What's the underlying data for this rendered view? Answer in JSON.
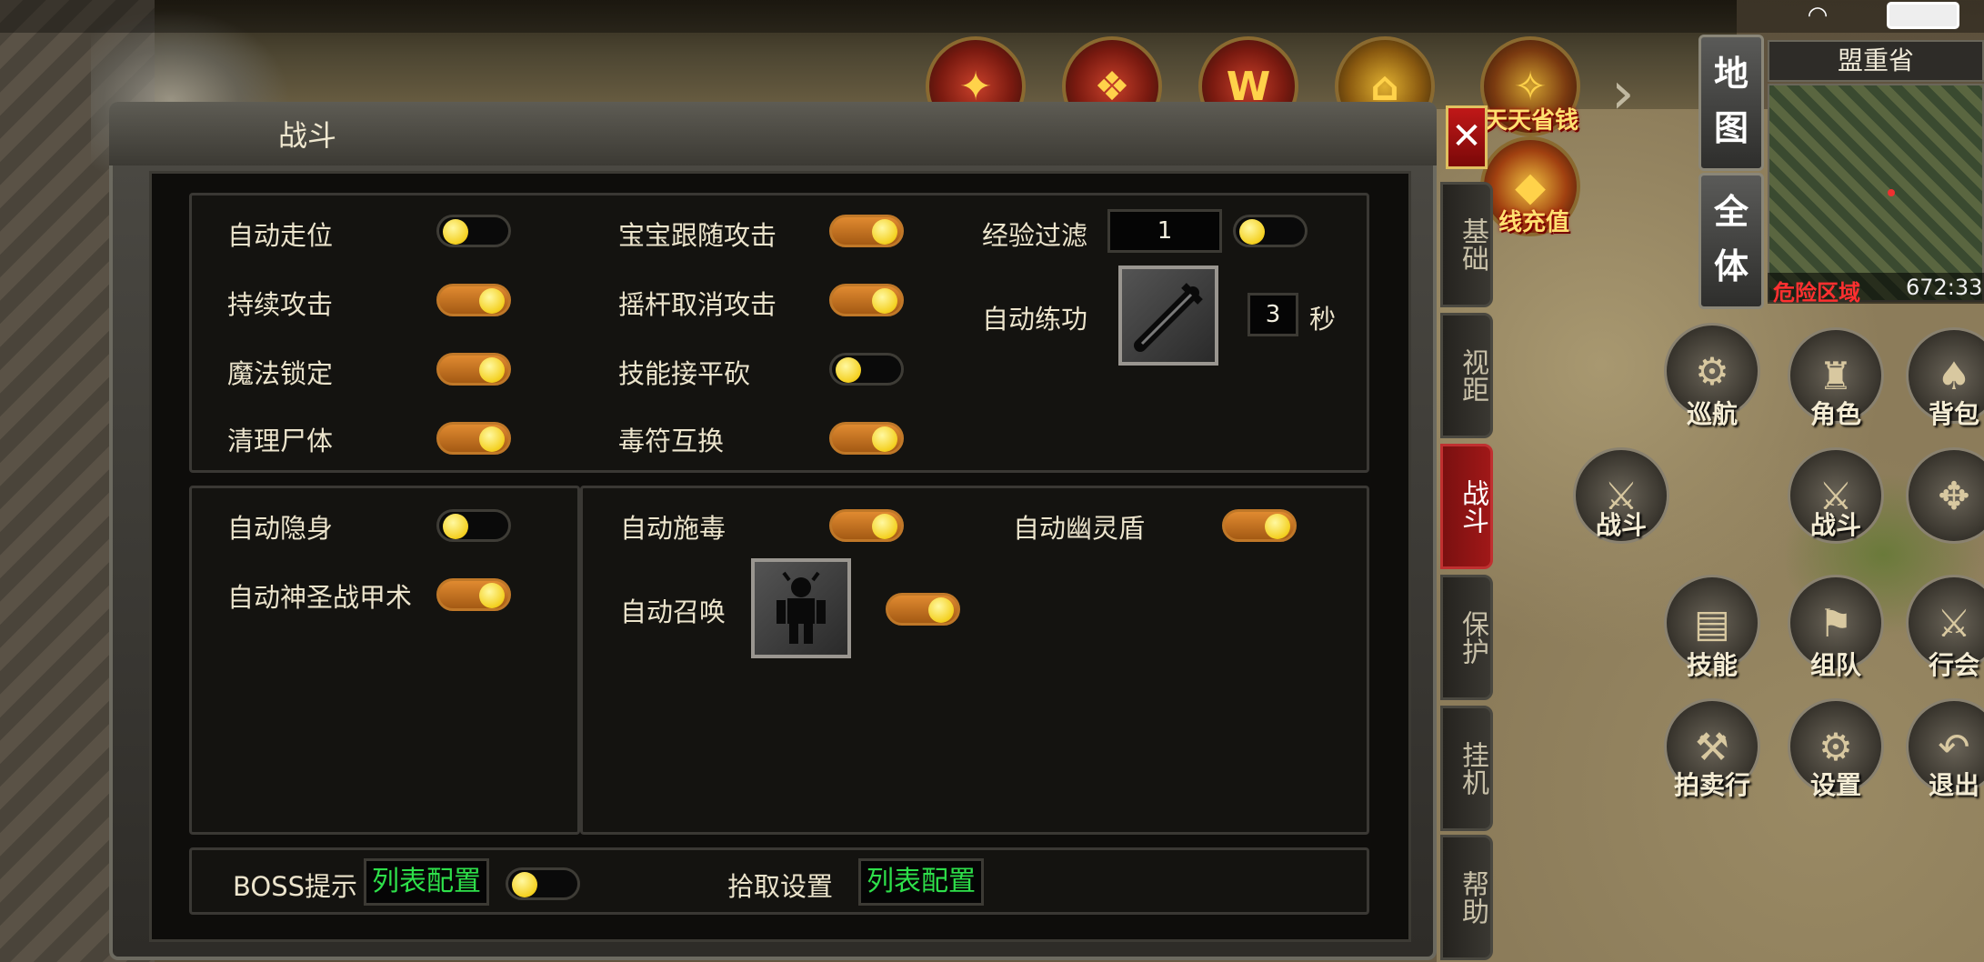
{
  "status_bar": {
    "wifi_icon": "wifi-icon",
    "battery_icon": "battery-icon"
  },
  "top_icons": [
    {
      "name": "event-icon",
      "label": ""
    },
    {
      "name": "gift-icon",
      "label": ""
    },
    {
      "name": "w-icon",
      "label": ""
    },
    {
      "name": "pavilion-icon",
      "label": ""
    },
    {
      "name": "save-money-icon",
      "label": "天天省钱"
    },
    {
      "name": "recharge-icon",
      "label": "线充值"
    }
  ],
  "minimap": {
    "map_button": "地图",
    "all_button": "全体",
    "region_name": "盟重省",
    "danger_text": "危险区域",
    "coords": "672:33"
  },
  "round_buttons": [
    {
      "label": "巡航"
    },
    {
      "label": "角色"
    },
    {
      "label": "背包"
    },
    {
      "label": "战斗"
    },
    {
      "label": "战斗"
    },
    {
      "label": "技能"
    },
    {
      "label": "组队"
    },
    {
      "label": "行会"
    },
    {
      "label": "拍卖行"
    },
    {
      "label": "设置"
    },
    {
      "label": "退出"
    }
  ],
  "panel": {
    "title": "战斗",
    "close_label": "✕",
    "tabs": [
      {
        "label": "基础",
        "active": false
      },
      {
        "label": "视距",
        "active": false
      },
      {
        "label": "战斗",
        "active": true
      },
      {
        "label": "保护",
        "active": false
      },
      {
        "label": "挂机",
        "active": false
      },
      {
        "label": "帮助",
        "active": false
      }
    ],
    "section1": {
      "col1": [
        {
          "label": "自动走位",
          "on": false
        },
        {
          "label": "持续攻击",
          "on": true
        },
        {
          "label": "魔法锁定",
          "on": true
        },
        {
          "label": "清理尸体",
          "on": true
        }
      ],
      "col2": [
        {
          "label": "宝宝跟随攻击",
          "on": true
        },
        {
          "label": "摇杆取消攻击",
          "on": true
        },
        {
          "label": "技能接平砍",
          "on": false
        },
        {
          "label": "毒符互换",
          "on": true
        }
      ],
      "exp_filter": {
        "label": "经验过滤",
        "value": "1",
        "on": false
      },
      "auto_practice": {
        "label": "自动练功",
        "seconds": "3",
        "unit": "秒"
      }
    },
    "section2": {
      "left": [
        {
          "label": "自动隐身",
          "on": false
        },
        {
          "label": "自动神圣战甲术",
          "on": true
        }
      ],
      "auto_poison": {
        "label": "自动施毒",
        "on": true
      },
      "auto_ghost_shield": {
        "label": "自动幽灵盾",
        "on": true
      },
      "auto_summon": {
        "label": "自动召唤",
        "on": true
      }
    },
    "footer": {
      "boss_label": "BOSS提示",
      "boss_config": "列表配置",
      "boss_on": false,
      "pickup_label": "拾取设置",
      "pickup_config": "列表配置"
    }
  },
  "colors": {
    "toggle_on": "#c07828",
    "knob": "#f4d020",
    "config_green": "#2ee04a",
    "active_tab": "#a01818"
  }
}
